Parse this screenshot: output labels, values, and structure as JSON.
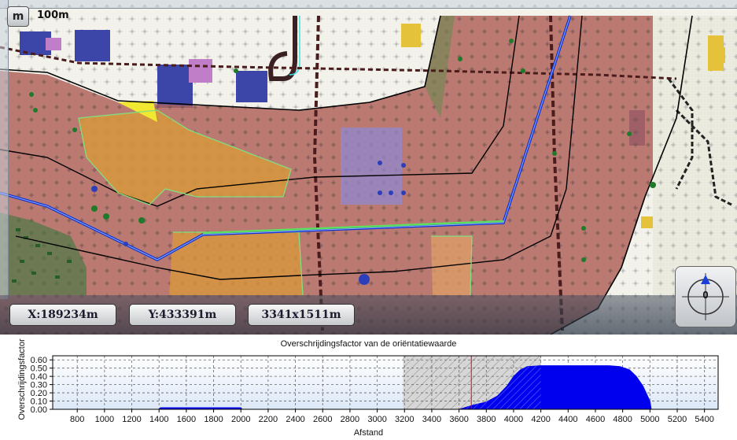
{
  "map": {
    "scale_button": "m",
    "scale_label": "100m",
    "x_coord": "X:189234m",
    "y_coord": "Y:433391m",
    "extent": "3341x1511m",
    "compass_value": "0",
    "colors": {
      "risk_zone": "#b0645c",
      "road": "#1030d0",
      "green_line": "#5ee05e",
      "orange": "#d99a3a",
      "purple": "#8f88d0"
    }
  },
  "chart_data": {
    "type": "area",
    "title": "Overschrijdingsfactor van de oriëntatiewaarde",
    "xlabel": "Afstand",
    "ylabel": "Overschrijdingsfactor",
    "xlim": [
      620,
      5500
    ],
    "ylim": [
      0,
      0.65
    ],
    "x_ticks": [
      800,
      1000,
      1200,
      1400,
      1600,
      1800,
      2000,
      2200,
      2400,
      2600,
      2800,
      3000,
      3200,
      3400,
      3600,
      3800,
      4000,
      4200,
      4400,
      4600,
      4800,
      5000,
      5200,
      5400
    ],
    "y_ticks": [
      "0.00",
      "0.10",
      "0.20",
      "0.30",
      "0.40",
      "0.50",
      "0.60"
    ],
    "grid": true,
    "series": [
      {
        "color": "#0000ee",
        "x": [
          620,
          1400,
          1410,
          2000,
          2010,
          3600,
          3700,
          3800,
          3880,
          3950,
          4000,
          4050,
          4100,
          4200,
          4700,
          4780,
          4850,
          4900,
          4950,
          5000,
          5010,
          5500
        ],
        "y": [
          0,
          0,
          0.02,
          0.02,
          0,
          0,
          0.05,
          0.09,
          0.16,
          0.28,
          0.4,
          0.48,
          0.52,
          0.53,
          0.53,
          0.52,
          0.48,
          0.4,
          0.28,
          0.1,
          0,
          0
        ]
      }
    ],
    "highlight_band": {
      "from": 3190,
      "to": 4200
    },
    "marker_x": 3690
  }
}
